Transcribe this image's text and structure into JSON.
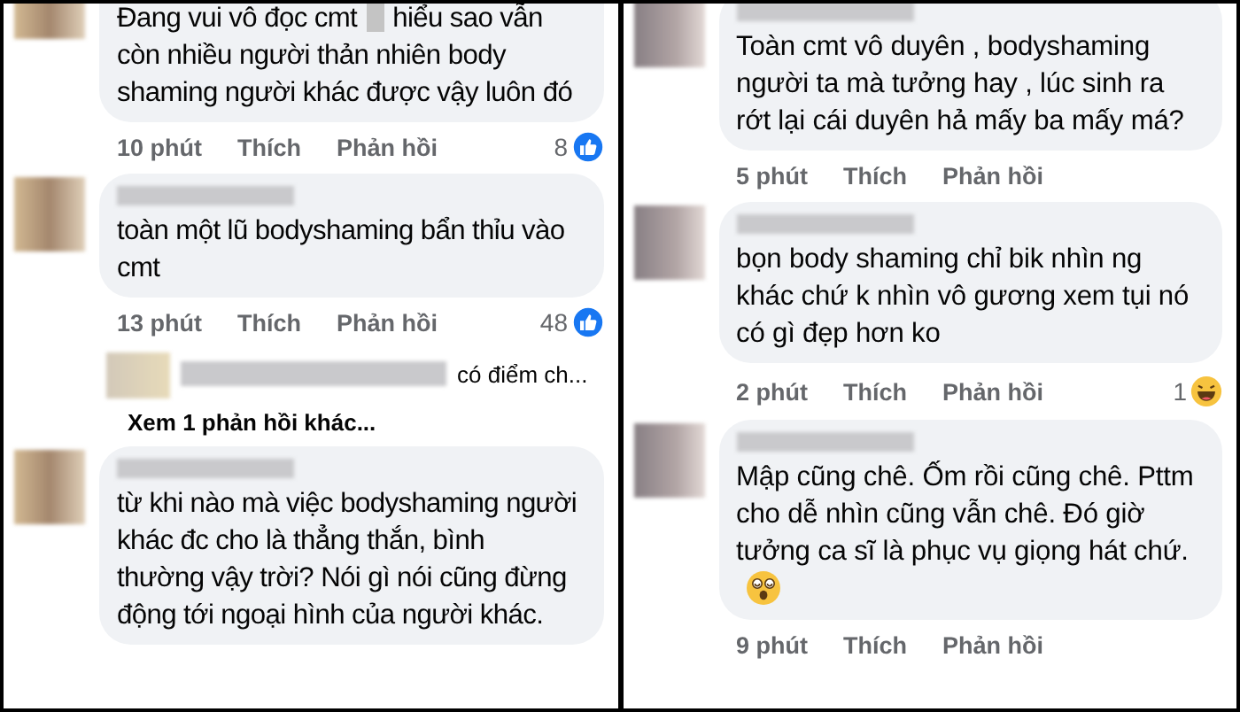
{
  "panels": [
    {
      "items": [
        {
          "kind": "comment",
          "text_parts": [
            "Đang vui vô đọc cmt",
            "hiểu sao vẫn còn nhiều người thản nhiên body shaming người khác được vậy luôn đó"
          ],
          "ends_with_emoji": false,
          "time": "10 phút",
          "like_label": "Thích",
          "reply_label": "Phản hồi",
          "reaction": {
            "kind": "like",
            "count": "8"
          }
        },
        {
          "kind": "comment",
          "text_parts": [
            "toàn một lũ bodyshaming bẩn thỉu vào cmt"
          ],
          "ends_with_emoji": false,
          "time": "13 phút",
          "like_label": "Thích",
          "reply_label": "Phản hồi",
          "reaction": {
            "kind": "like",
            "count": "48"
          }
        },
        {
          "kind": "reply_preview",
          "text": "có điểm ch..."
        },
        {
          "kind": "more_replies",
          "text": "Xem 1 phản hồi khác..."
        },
        {
          "kind": "comment",
          "text_parts": [
            "từ khi nào mà việc bodyshaming người khác đc cho là thẳng thắn, bình thường vậy trời? Nói gì nói cũng đừng động tới ngoại hình của người khác."
          ],
          "ends_with_emoji": false
        }
      ]
    },
    {
      "items": [
        {
          "kind": "comment",
          "text_parts": [
            "Toàn cmt vô duyên , bodyshaming người ta mà tưởng hay , lúc sinh ra rớt lại cái duyên hả mấy ba mấy má?"
          ],
          "ends_with_emoji": false,
          "time": "5 phút",
          "like_label": "Thích",
          "reply_label": "Phản hồi"
        },
        {
          "kind": "comment",
          "text_parts": [
            "bọn body shaming chỉ bik nhìn ng khác chứ k nhìn vô gương xem tụi nó có gì đẹp hơn ko"
          ],
          "ends_with_emoji": false,
          "time": "2 phút",
          "like_label": "Thích",
          "reply_label": "Phản hồi",
          "reaction": {
            "kind": "haha",
            "count": "1"
          }
        },
        {
          "kind": "comment",
          "text_parts": [
            "Mập cũng chê. Ốm rồi cũng chê. Pttm cho dễ nhìn cũng vẫn chê. Đó giờ tưởng ca sĩ là phục vụ giọng hát chứ."
          ],
          "ends_with_emoji": true,
          "time": "9 phút",
          "like_label": "Thích",
          "reply_label": "Phản hồi"
        }
      ]
    }
  ]
}
